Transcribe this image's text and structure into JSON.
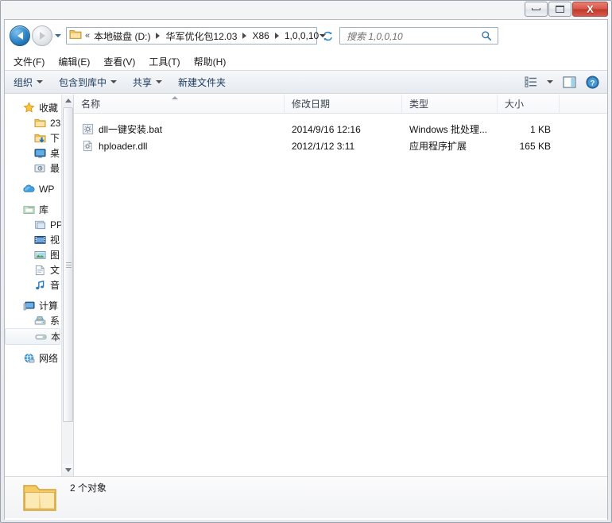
{
  "window": {
    "buttons": {
      "minimize": "minimize",
      "maximize": "maximize",
      "close": "X"
    }
  },
  "address": {
    "chevron": "«",
    "crumbs": [
      "本地磁盘 (D:)",
      "华军优化包12.03",
      "X86",
      "1,0,0,10"
    ],
    "folder_icon": "folder-icon",
    "dropdown_icon": "chevron-down-icon",
    "refresh_icon": "refresh-icon",
    "back_icon": "back-arrow-icon",
    "forward_icon": "forward-arrow-icon",
    "history_icon": "history-chevron-icon"
  },
  "search": {
    "placeholder": "搜索 1,0,0,10",
    "value": "",
    "icon": "search-icon"
  },
  "menubar": {
    "items": [
      {
        "label": "文件(F)"
      },
      {
        "label": "编辑(E)"
      },
      {
        "label": "查看(V)"
      },
      {
        "label": "工具(T)"
      },
      {
        "label": "帮助(H)"
      }
    ]
  },
  "toolbar": {
    "buttons": [
      {
        "label": "组织",
        "has_caret": true
      },
      {
        "label": "包含到库中",
        "has_caret": true
      },
      {
        "label": "共享",
        "has_caret": true
      },
      {
        "label": "新建文件夹",
        "has_caret": false
      }
    ],
    "view_icon": "view-options-icon",
    "view_caret": "chevron-down-icon",
    "preview_icon": "preview-pane-icon",
    "help_icon": "help-icon"
  },
  "navpane": {
    "groups": [
      {
        "header": {
          "label": "收藏",
          "icon": "star-icon"
        },
        "items": [
          {
            "label": "23",
            "icon": "folder-icon"
          },
          {
            "label": "下",
            "icon": "downloads-icon"
          },
          {
            "label": "桌",
            "icon": "desktop-icon"
          },
          {
            "label": "最",
            "icon": "recent-places-icon"
          }
        ]
      },
      {
        "header": {
          "label": "WP",
          "icon": "cloud-icon"
        },
        "items": []
      },
      {
        "header": {
          "label": "库",
          "icon": "library-icon"
        },
        "items": [
          {
            "label": "PP",
            "icon": "documents-library-icon"
          },
          {
            "label": "视",
            "icon": "video-library-icon"
          },
          {
            "label": "图",
            "icon": "pictures-library-icon"
          },
          {
            "label": "文",
            "icon": "documents-icon"
          },
          {
            "label": "音",
            "icon": "music-library-icon"
          }
        ]
      },
      {
        "header": {
          "label": "计算",
          "icon": "computer-icon"
        },
        "items": [
          {
            "label": "系",
            "icon": "system-drive-icon",
            "selected": false
          },
          {
            "label": "本",
            "icon": "local-disk-icon",
            "selected": true
          }
        ]
      },
      {
        "header": {
          "label": "网络",
          "icon": "network-icon"
        },
        "items": []
      }
    ],
    "scrollbar": {
      "up_icon": "scroll-up-icon",
      "down_icon": "scroll-down-icon"
    }
  },
  "filelist": {
    "columns": [
      {
        "key": "name",
        "label": "名称"
      },
      {
        "key": "date",
        "label": "修改日期"
      },
      {
        "key": "type",
        "label": "类型"
      },
      {
        "key": "size",
        "label": "大小"
      }
    ],
    "rows": [
      {
        "name": "dll一键安装.bat",
        "date": "2014/9/16 12:16",
        "type": "Windows 批处理...",
        "size": "1 KB",
        "icon": "bat-file-icon"
      },
      {
        "name": "hploader.dll",
        "date": "2012/1/12 3:11",
        "type": "应用程序扩展",
        "size": "165 KB",
        "icon": "dll-file-icon"
      }
    ]
  },
  "statusbar": {
    "text": "2 个对象",
    "icon": "folder-icon"
  },
  "colors": {
    "accent": "#2e86c8",
    "close_button": "#c0392b",
    "folder_yellow": "#f5c956",
    "window_bg": "#eceef1",
    "list_bg": "#ffffff"
  }
}
